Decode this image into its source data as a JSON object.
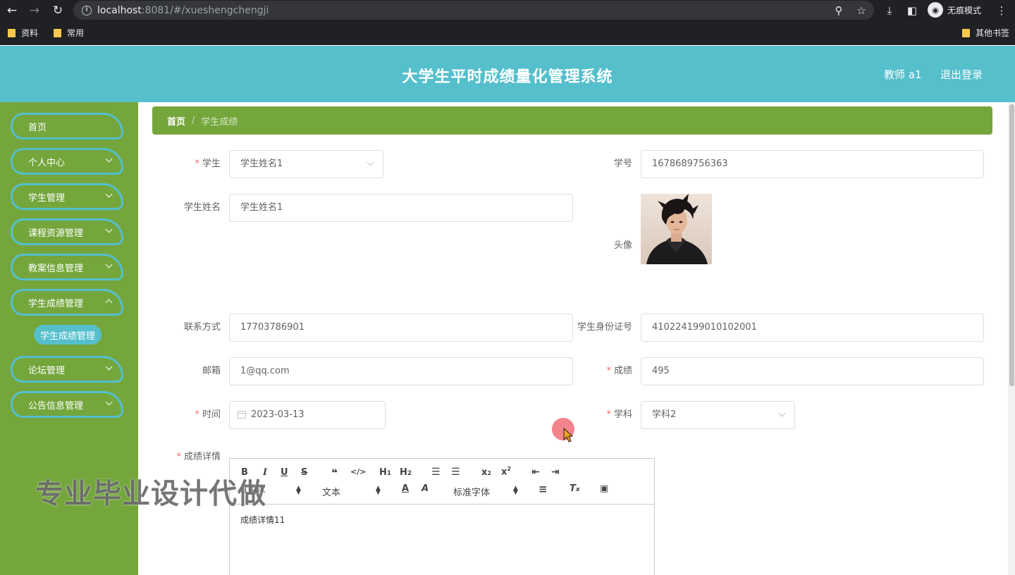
{
  "browser": {
    "url_host": "localhost",
    "url_rest": ":8081/#/xueshengchengji",
    "incognito_label": "无痕模式",
    "bookmarks": [
      "资料",
      "常用"
    ],
    "other_bookmarks": "其他书签"
  },
  "header": {
    "title": "大学生平时成绩量化管理系统",
    "user": "教师 a1",
    "logout": "退出登录"
  },
  "sidebar": {
    "items": [
      {
        "label": "首页"
      },
      {
        "label": "个人中心"
      },
      {
        "label": "学生管理"
      },
      {
        "label": "课程资源管理"
      },
      {
        "label": "教案信息管理"
      },
      {
        "label": "学生成绩管理"
      },
      {
        "label": "论坛管理"
      },
      {
        "label": "公告信息管理"
      }
    ],
    "active_sub": "学生成绩管理"
  },
  "breadcrumb": {
    "home": "首页",
    "sep": "/",
    "current": "学生成绩"
  },
  "form": {
    "student_label": "学生",
    "student_value": "学生姓名1",
    "student_no_label": "学号",
    "student_no_value": "1678689756363",
    "student_name_label": "学生姓名",
    "student_name_value": "学生姓名1",
    "avatar_label": "头像",
    "phone_label": "联系方式",
    "phone_value": "17703786901",
    "id_label": "学生身份证号",
    "id_value": "410224199010102001",
    "email_label": "邮箱",
    "email_value": "1@qq.com",
    "score_label": "成绩",
    "score_value": "495",
    "date_label": "时间",
    "date_value": "2023-03-13",
    "subject_label": "学科",
    "subject_value": "学科2",
    "detail_label": "成绩详情",
    "required_mark": "*"
  },
  "editor": {
    "font_size": "14px",
    "paragraph": "文本",
    "font_family": "标准字体",
    "content": "成绩详情11"
  },
  "watermark": "专业毕业设计代做"
}
